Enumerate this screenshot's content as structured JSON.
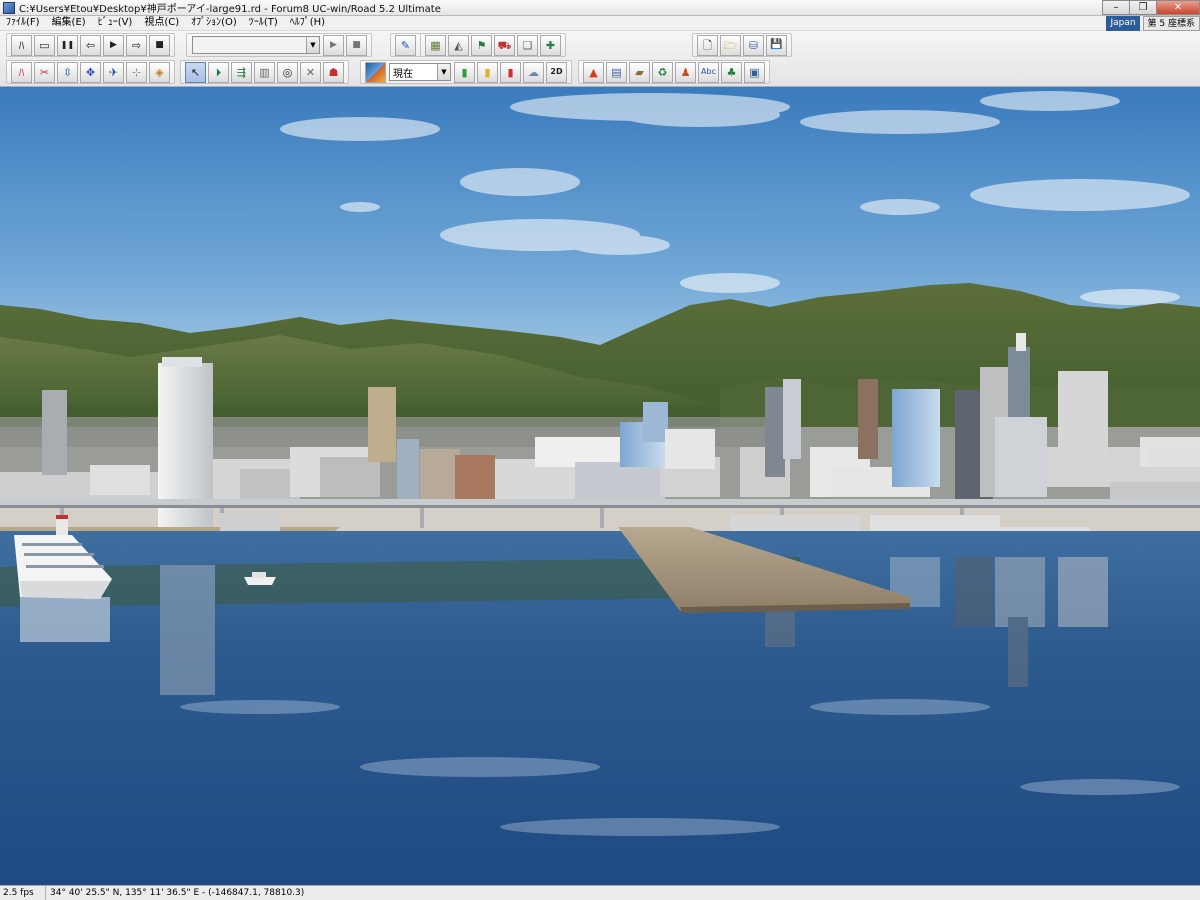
{
  "window": {
    "title": "C:¥Users¥Etou¥Desktop¥神戸ポーアイ-large91.rd - Forum8 UC-win/Road 5.2 Ultimate",
    "minimize_label": "–",
    "maximize_label": "❐",
    "close_label": "✕"
  },
  "menu": {
    "items": [
      "ﾌｧｲﾙ(F)",
      "編集(E)",
      "ﾋﾞｭｰ(V)",
      "視点(C)",
      "ｵﾌﾟｼｮﾝ(O)",
      "ﾂｰﾙ(T)",
      "ﾍﾙﾌﾟ(H)"
    ],
    "region": "Japan",
    "coordinate_system": "第 5 座標系"
  },
  "toolbar": {
    "row1_group1": [
      "road-icon",
      "folder-icon",
      "pause-icon",
      "step-back-icon",
      "play-icon",
      "step-forward-icon",
      "stop-icon"
    ],
    "row1_group1_glyphs": [
      "ﾊ",
      "▭",
      "❚❚",
      "⇦",
      "▶",
      "⇨",
      "■"
    ],
    "scenario_combo_value": "",
    "scenario_play_glyph": "▶",
    "scenario_stop_glyph": "■",
    "row1_group2_glyphs": [
      "✎"
    ],
    "row1_group3_glyphs": [
      "▦",
      "◭",
      "⚑",
      "⛟",
      "❏",
      "✚"
    ],
    "row1_group4_glyphs": [
      "🗋",
      "🗁",
      "⛁",
      "💾"
    ],
    "row2_group1_glyphs": [
      "ﾊ",
      "✂",
      "⇳",
      "✥",
      "✈",
      "⊹",
      "◈"
    ],
    "row2_group2_glyphs": [
      "↖",
      "⏵",
      "⇶",
      "▥",
      "◎",
      "✕",
      "☗"
    ],
    "time_combo_value": "現在",
    "row2_group3_glyphs": [
      "▮",
      "▮",
      "▮",
      "☁",
      "2D"
    ],
    "row2_group4_glyphs": [
      "▲",
      "▤",
      "▰",
      "♻",
      "♟",
      "Abc",
      "♣",
      "▣"
    ]
  },
  "status": {
    "fps": "2.5 fps",
    "location": "34°  40' 25.5\" N, 135°  11' 36.5\" E  - (-146847.1, 78810.3)"
  },
  "colors": {
    "sky_top": "#3d7fc0",
    "sky_bottom": "#8fbde0",
    "mountain": "#55703a",
    "water": "#2a5a90",
    "titlebar_close": "#c8452e"
  }
}
